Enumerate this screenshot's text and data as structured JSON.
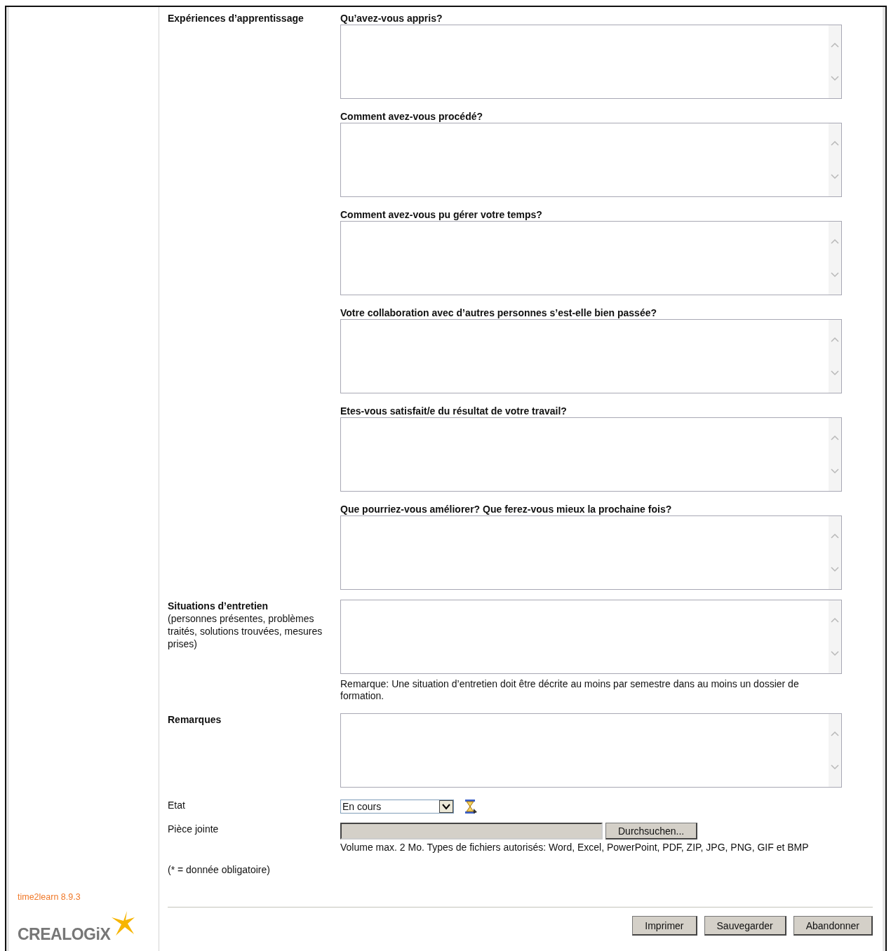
{
  "learning_experiences": {
    "label": "Expériences d’apprentissage",
    "questions": [
      {
        "label": "Qu’avez-vous appris?"
      },
      {
        "label": "Comment avez-vous procédé?"
      },
      {
        "label": "Comment avez-vous pu gérer votre temps?"
      },
      {
        "label": "Votre collaboration avec d’autres personnes s’est-elle bien passée?"
      },
      {
        "label": "Etes-vous satisfait/e du résultat de votre travail?"
      },
      {
        "label": "Que pourriez-vous améliorer? Que ferez-vous mieux la prochaine fois?"
      }
    ]
  },
  "interview_situations": {
    "label": "Situations d’entretien",
    "hint": "(personnes présentes, problèmes traités, solutions trouvées, mesures prises)",
    "note": "Remarque: Une situation d’entretien doit être décrite au moins par semestre dans au moins un dossier de formation."
  },
  "remarks": {
    "label": "Remarques"
  },
  "status": {
    "label": "Etat",
    "value": "En cours"
  },
  "attachment": {
    "label": "Pièce jointe",
    "button": "Durchsuchen...",
    "hint": "Volume max. 2 Mo. Types de fichiers autorisés: Word, Excel, PowerPoint, PDF, ZIP, JPG, PNG, GIF et BMP"
  },
  "required_note": "(* = donnée obligatoire)",
  "version": "time2learn 8.9.3",
  "logo": {
    "text": "CREALOGiX"
  },
  "buttons": [
    "Imprimer",
    "Sauvegarder",
    "Abandonner"
  ]
}
